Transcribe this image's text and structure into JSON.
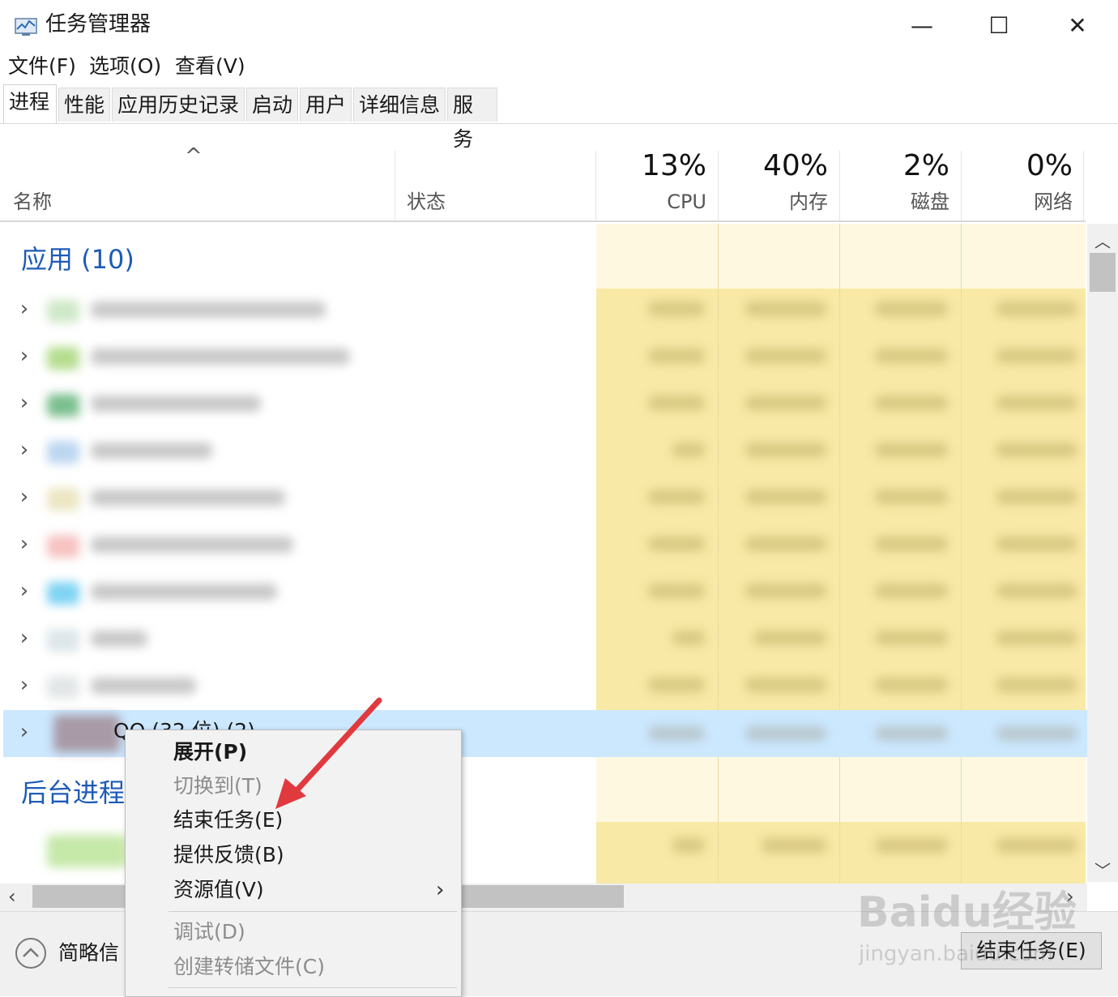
{
  "window": {
    "title": "任务管理器",
    "minimize": "—",
    "maximize": "☐",
    "close": "✕"
  },
  "menu": [
    "文件(F)",
    "选项(O)",
    "查看(V)"
  ],
  "tabs": [
    "进程",
    "性能",
    "应用历史记录",
    "启动",
    "用户",
    "详细信息",
    "服务"
  ],
  "active_tab": "进程",
  "columns": {
    "sort_indicator": "^",
    "name": "名称",
    "status": "状态",
    "cpu": {
      "percent": "13%",
      "label": "CPU"
    },
    "memory": {
      "percent": "40%",
      "label": "内存"
    },
    "disk": {
      "percent": "2%",
      "label": "磁盘"
    },
    "network": {
      "percent": "0%",
      "label": "网络"
    }
  },
  "groups": {
    "apps": "应用 (10)",
    "background": "后台进程"
  },
  "selected_row": {
    "name": "QQ (32 位) (2)"
  },
  "context_menu": {
    "expand": "展开(P)",
    "switch_to": "切换到(T)",
    "end_task": "结束任务(E)",
    "feedback": "提供反馈(B)",
    "resource_values": "资源值(V)",
    "submenu_arrow": "›",
    "debug": "调试(D)",
    "create_dump": "创建转储文件(C)"
  },
  "footer": {
    "fewer_details": "简略信",
    "end_task_button": "结束任务(E)"
  },
  "watermark": {
    "text": "Baidu经验",
    "url": "jingyan.baidu.com"
  },
  "colors": {
    "group_header": "#1e5bb6",
    "selected_row": "#cce8ff",
    "heat": "#f8e9a6",
    "heat_light": "#fff8e1",
    "annotation_arrow": "#e0393e"
  }
}
